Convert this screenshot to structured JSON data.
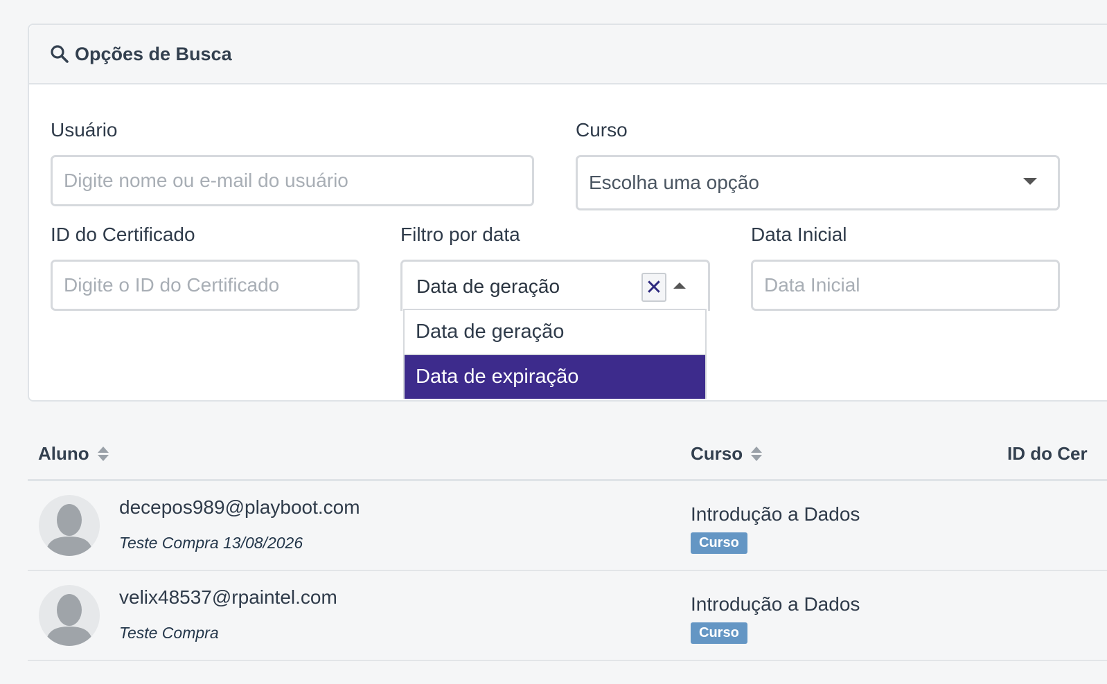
{
  "search": {
    "title": "Opções de Busca",
    "usuario": {
      "label": "Usuário",
      "placeholder": "Digite nome ou e-mail do usuário"
    },
    "curso": {
      "label": "Curso",
      "value": "Escolha uma opção"
    },
    "certificado": {
      "label": "ID do Certificado",
      "placeholder": "Digite o ID do Certificado"
    },
    "filtro": {
      "label": "Filtro por data",
      "value": "Data de geração",
      "clear": "✕",
      "options": [
        "Data de geração",
        "Data de expiração"
      ],
      "highlighted": "Data de expiração"
    },
    "data_inicial": {
      "label": "Data Inicial",
      "placeholder": "Data Inicial"
    }
  },
  "table": {
    "headers": [
      "Aluno",
      "Curso",
      "ID do Cer"
    ],
    "rows": [
      {
        "email": "decepos989@playboot.com",
        "sub": "Teste Compra 13/08/2026",
        "course": "Introdução a Dados",
        "badge": "Curso"
      },
      {
        "email": "velix48537@rpaintel.com",
        "sub": "Teste Compra",
        "course": "Introdução a Dados",
        "badge": "Curso"
      }
    ]
  },
  "colors": {
    "highlight": "#3d2b8c",
    "badge": "#6496c4"
  }
}
